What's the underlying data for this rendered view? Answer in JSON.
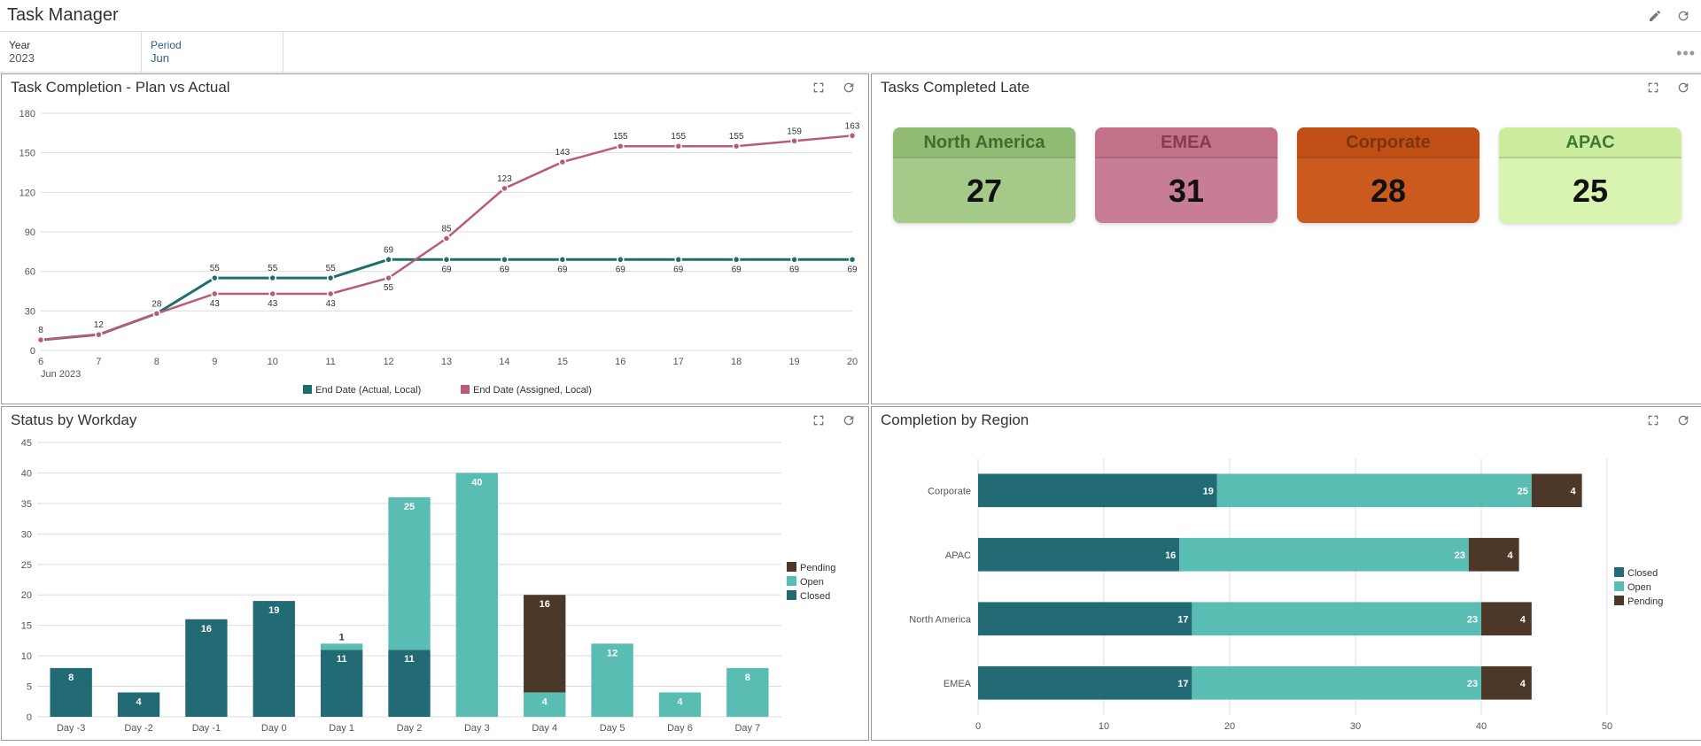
{
  "title": "Task Manager",
  "filters": {
    "year_label": "Year",
    "year_value": "2023",
    "period_label": "Period",
    "period_value": "Jun"
  },
  "panels": {
    "plan_vs_actual": {
      "title": "Task Completion - Plan vs Actual"
    },
    "late": {
      "title": "Tasks Completed Late"
    },
    "status": {
      "title": "Status by Workday"
    },
    "region": {
      "title": "Completion by Region"
    }
  },
  "kpis": [
    {
      "label": "North America",
      "value": "27",
      "bg": "#a4c989",
      "bg2": "#8fbb72",
      "label_color": "#446b2e",
      "value_color": "#111"
    },
    {
      "label": "EMEA",
      "value": "31",
      "bg": "#c77d93",
      "bg2": "#c27189",
      "label_color": "#8a3a50",
      "value_color": "#111"
    },
    {
      "label": "Corporate",
      "value": "28",
      "bg": "#cb5a1e",
      "bg2": "#c04f15",
      "label_color": "#7a3510",
      "value_color": "#111"
    },
    {
      "label": "APAC",
      "value": "25",
      "bg": "#d9f3b0",
      "bg2": "#cced9e",
      "label_color": "#3d7a35",
      "value_color": "#111"
    }
  ],
  "chart_data": [
    {
      "id": "plan_vs_actual",
      "type": "line",
      "title": "Task Completion - Plan vs Actual",
      "xlabel": "Jun 2023",
      "ylabel": "",
      "ylim": [
        0,
        180
      ],
      "yticks": [
        0,
        30,
        60,
        90,
        120,
        150,
        180
      ],
      "categories": [
        "6",
        "7",
        "8",
        "9",
        "10",
        "11",
        "12",
        "13",
        "14",
        "15",
        "16",
        "17",
        "18",
        "19",
        "20"
      ],
      "series": [
        {
          "name": "End Date (Actual, Local)",
          "color": "#1f6e6e",
          "values": [
            8,
            12,
            28,
            55,
            55,
            55,
            69,
            69,
            69,
            69,
            69,
            69,
            69,
            69,
            69
          ]
        },
        {
          "name": "End Date (Assigned, Local)",
          "color": "#ba5a79",
          "values": [
            8,
            12,
            28,
            43,
            43,
            43,
            55,
            85,
            123,
            143,
            155,
            155,
            155,
            159,
            163
          ]
        }
      ]
    },
    {
      "id": "status_by_workday",
      "type": "bar",
      "title": "Status by Workday",
      "xlabel": "",
      "ylabel": "",
      "ylim": [
        0,
        45
      ],
      "yticks": [
        0,
        5,
        10,
        15,
        20,
        25,
        30,
        35,
        40,
        45
      ],
      "categories": [
        "Day -3",
        "Day -2",
        "Day -1",
        "Day 0",
        "Day 1",
        "Day 2",
        "Day 3",
        "Day 4",
        "Day 5",
        "Day 6",
        "Day 7"
      ],
      "stacked": true,
      "series": [
        {
          "name": "Closed",
          "color": "#226a74",
          "values": [
            8,
            4,
            16,
            19,
            11,
            11,
            0,
            0,
            0,
            0,
            0
          ]
        },
        {
          "name": "Open",
          "color": "#5abdb3",
          "values": [
            0,
            0,
            0,
            0,
            1,
            25,
            40,
            4,
            12,
            4,
            8
          ]
        },
        {
          "name": "Pending",
          "color": "#4b3828",
          "values": [
            0,
            0,
            0,
            0,
            0,
            0,
            0,
            16,
            0,
            0,
            0
          ]
        }
      ],
      "legend_labels": {
        "pending": "Pending",
        "open": "Open",
        "closed": "Closed"
      }
    },
    {
      "id": "completion_by_region",
      "type": "bar",
      "orientation": "horizontal",
      "title": "Completion by Region",
      "xlabel": "",
      "ylabel": "",
      "xlim": [
        0,
        50
      ],
      "xticks": [
        0,
        10,
        20,
        30,
        40,
        50
      ],
      "categories": [
        "Corporate",
        "APAC",
        "North America",
        "EMEA"
      ],
      "stacked": true,
      "series": [
        {
          "name": "Closed",
          "color": "#226a74",
          "values": [
            19,
            16,
            17,
            17
          ]
        },
        {
          "name": "Open",
          "color": "#5abdb3",
          "values": [
            25,
            23,
            23,
            23
          ]
        },
        {
          "name": "Pending",
          "color": "#4b3828",
          "values": [
            4,
            4,
            4,
            4
          ]
        }
      ],
      "legend_labels": {
        "closed": "Closed",
        "open": "Open",
        "pending": "Pending"
      }
    },
    {
      "id": "tasks_completed_late",
      "type": "table",
      "title": "Tasks Completed Late",
      "rows": [
        {
          "region": "North America",
          "count": 27
        },
        {
          "region": "EMEA",
          "count": 31
        },
        {
          "region": "Corporate",
          "count": 28
        },
        {
          "region": "APAC",
          "count": 25
        }
      ]
    }
  ]
}
